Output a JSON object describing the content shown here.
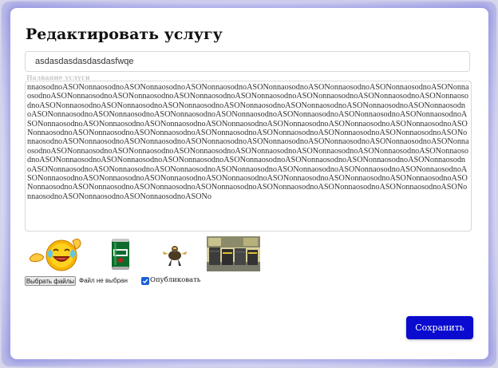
{
  "modal": {
    "title": "Редактировать услугу",
    "name_value": "asdasdasdasdasdasfwqe",
    "name_label": "Название услуги",
    "description_value": "nnaosodnoASONonnaosodnoASONonnaosodnoASONonnaosodnoASONonnaosodnoASONonnaosodnoASONonnaosodnoASONonnaosodnoASONonnaosodnoASONonnaosodnoASONonnaosodnoASONonnaosodnoASONonnaosodnoASONonnaosodnoASONonnaosodnoASONonnaosodnoASONonnaosodnoASONonnaosodnoASONonnaosodnoASONonnaosodnoASONonnaosodnoASONonnaosodnoASONonnaosodnoASONonnaosodnoASONonnaosodnoASONonnaosodnoASONonnaosodnoASONonnaosodnoASONonnaosodnoASONonnaosodnoASONonnaosodnoASONonnaosodnoASONonnaosodnoASONonnaosodnoASONonnaosodnoASONonnaosodnoASONonnaosodnoASONonnaosodnoASONonnaosodnoASONonnaosodnoASONonnaosodnoASONonnaosodnoASONonnaosodnoASONonnaosodnoASONonnaosodnoASONonnaosodnoASONonnaosodnoASONonnaosodnoASONonnaosodnoASONonnaosodnoASONonnaosodnoASONonnaosodnoASONonnaosodnoASONonnaosodnoASONonnaosodnoASONonnaosodnoASONonnaosodnoASONonnaosodnoASONonnaosodnoASONonnaosodnoASONonnaosodnoASONonnaosodnoASONonnaosodnoASONonnaosodnoASONonnaosodnoASONonnaosodnoASONonnaosodnoASONonnaosodnoASONonnaosodnoASONonnaosodnoASONonnaosodnoASONonnaosodnoASONonnaosodnoASONonnaosodnoASONonnaosodnoASONonnaosodnoASONonnaosodnoASONonnaosodnoASONonnaosodnoASONonnaosodnoASONonnaosodnoASONonnaosodnoASONonnaosodnoASONonnaosodnoASONonnaosodnoASONonnaosodnoASONonnaosodnoASONonnaosodnoASONonnaosodnoASONo",
    "images": [
      {
        "icon": "laughing-emoji-icon"
      },
      {
        "icon": "beer-can-icon"
      },
      {
        "icon": "creature-figure-icon"
      },
      {
        "icon": "dumpsters-scene-icon"
      }
    ],
    "file_button_label": "Выбрать файлы",
    "file_status": "Файл не выбран",
    "publish_label": "Опубликовать",
    "publish_checked": true,
    "save_label": "Сохранить"
  },
  "colors": {
    "accent": "#0b0bd0",
    "checkbox": "#1a5fd6",
    "placeholder_label": "#c9c9c9"
  }
}
